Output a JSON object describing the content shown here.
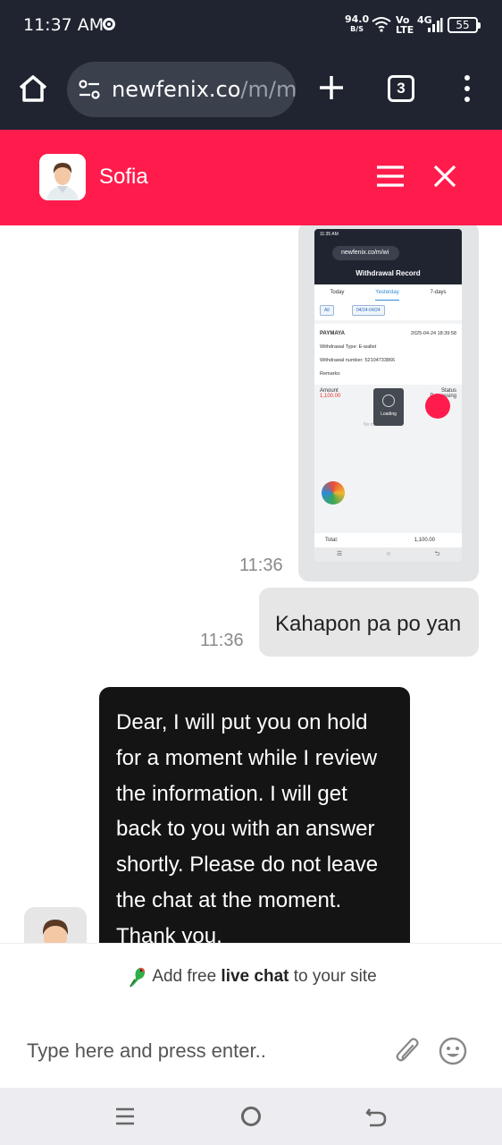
{
  "status_bar": {
    "time": "11:37 AM",
    "speed_value": "94.0",
    "speed_unit": "B/S",
    "volte": "Vo LTE",
    "network": "4G",
    "battery": "55"
  },
  "browser": {
    "url_host": "newfenix.co",
    "url_path": "/m/mo",
    "tab_count": "3",
    "icons": [
      "home-icon",
      "site-settings-icon",
      "new-tab-icon",
      "tab-switcher-icon",
      "menu-icon"
    ]
  },
  "chat_header": {
    "agent_name": "Sofia",
    "color": "#ff1c4d"
  },
  "screenshot_message": {
    "status_time": "11:35 AM",
    "url": "newfenix.co/m/wi",
    "title": "Withdrawal Record",
    "tabs": [
      "Today",
      "Yesterday",
      "7-days"
    ],
    "filter_all": "All",
    "filter_date": "04/24-04/24",
    "provider": "PAYMAYA",
    "datetime": "2025-04-24 18:39:58",
    "withdrawal_type_label": "Withdrawal Type:",
    "withdrawal_type_value": "E-wallet",
    "withdrawal_number_label": "Withdrawal number:",
    "withdrawal_number_value": "52104733866",
    "remarks_label": "Remarks:",
    "amount_label": "Amount",
    "amount_value": "1,100.00",
    "status_label": "Status",
    "status_value": "Processing",
    "loading_text": "Loading",
    "no_more_text": "No more records",
    "total_label": "Total:",
    "total_value": "1,100.00"
  },
  "messages": [
    {
      "type": "image",
      "time": "11:36"
    },
    {
      "type": "text",
      "direction": "out",
      "text": "Kahapon pa po yan",
      "time": "11:36"
    },
    {
      "type": "text",
      "direction": "in",
      "text": "Dear, I will put you on hold for a moment while I review the information. I will get back to you with an answer shortly. Please do not leave the chat at the moment. Thank you."
    }
  ],
  "composer": {
    "branding_prefix": "Add free ",
    "branding_bold": "live chat",
    "branding_suffix": " to your site",
    "placeholder": "Type here and press enter.."
  }
}
